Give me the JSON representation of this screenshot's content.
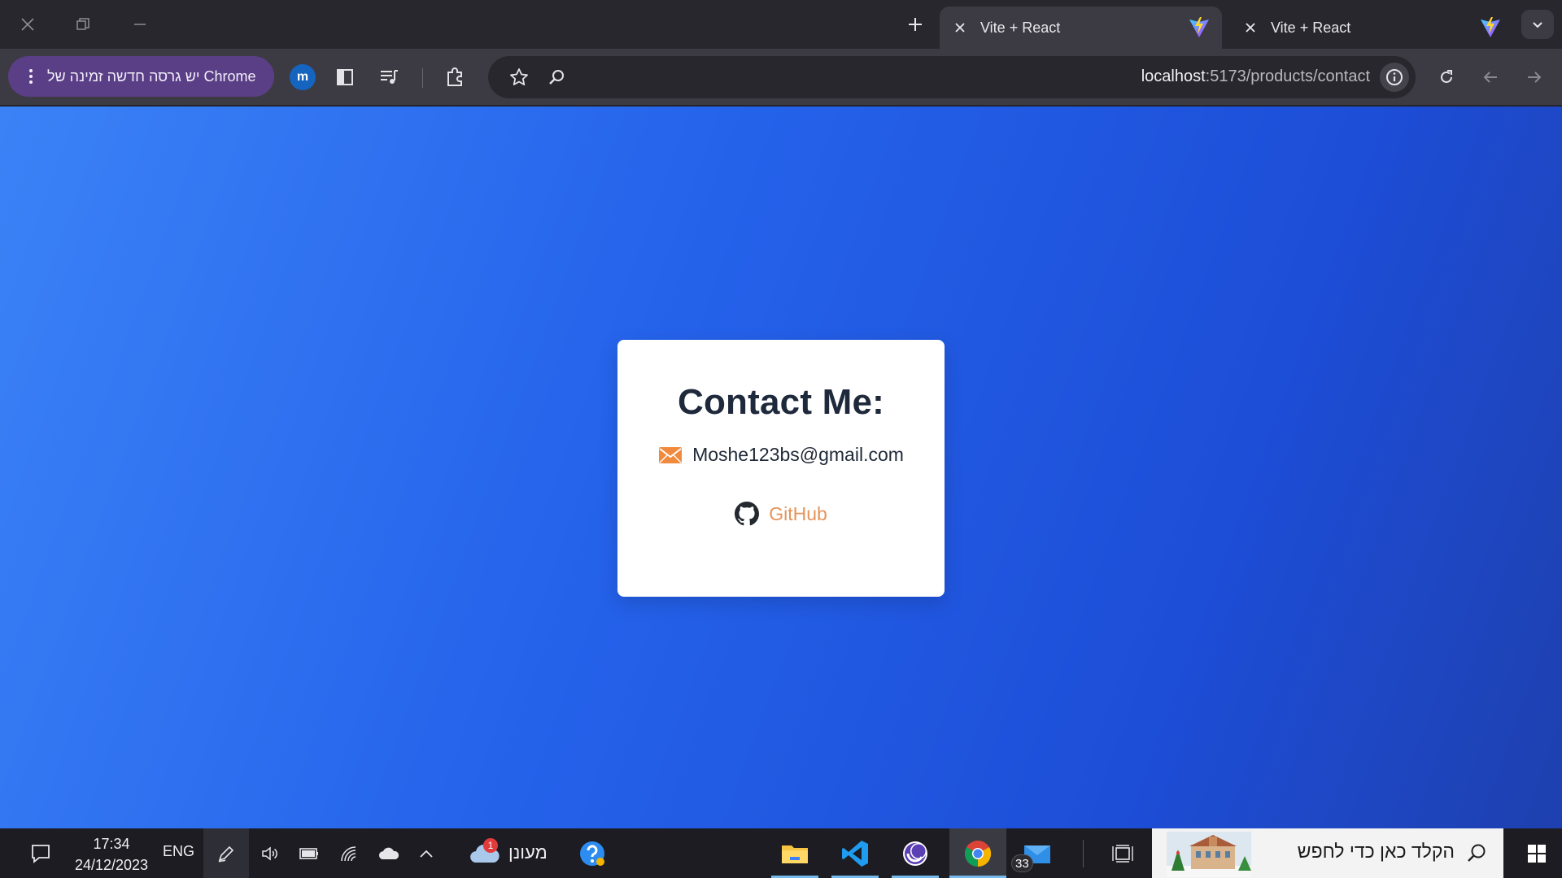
{
  "browser": {
    "tabs": [
      {
        "title": "Vite + React",
        "active": true
      },
      {
        "title": "Vite + React",
        "active": false
      }
    ],
    "update_notice": "יש גרסה חדשה זמינה של Chrome",
    "profile_initial": "m",
    "url_host": "localhost",
    "url_path": ":5173/products/contact"
  },
  "page": {
    "heading": "Contact Me:",
    "email": "Moshe123bs@gmail.com",
    "github_label": "GitHub",
    "accent_color": "#e5945a",
    "background_colors": [
      "#3b82f6",
      "#1e40af"
    ]
  },
  "taskbar": {
    "time": "17:34",
    "date": "24/12/2023",
    "language": "ENG",
    "weather_label": "מעונן",
    "weather_badge": "1",
    "mail_badge": "33",
    "search_placeholder": "הקלד כאן כדי לחפש"
  }
}
